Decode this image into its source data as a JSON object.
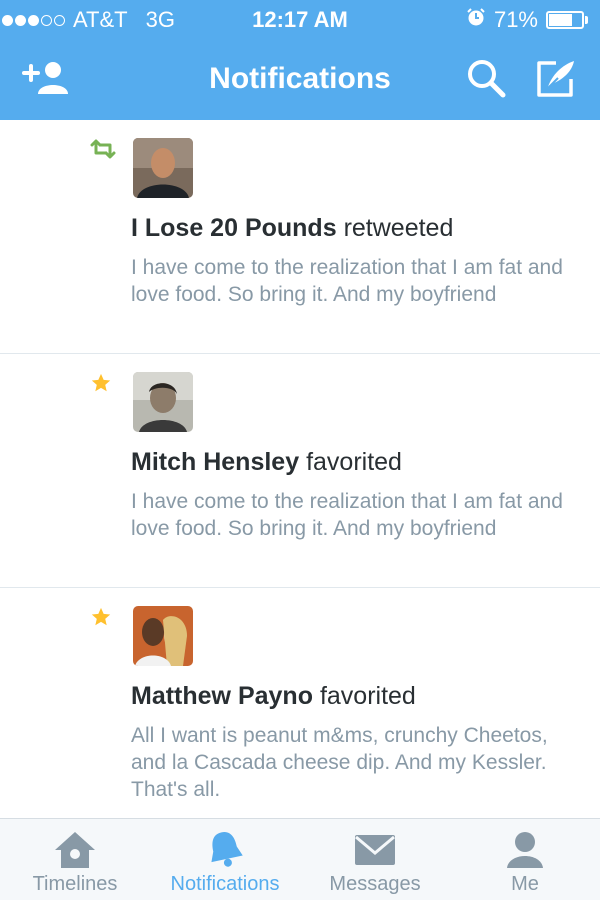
{
  "status_bar": {
    "signal_bars_filled": 3,
    "signal_bars_total": 5,
    "carrier": "AT&T",
    "network": "3G",
    "time": "12:17 AM",
    "battery_percent": "71%",
    "battery_level": 0.71
  },
  "nav": {
    "title": "Notifications",
    "left_icon": "add-user-icon",
    "right_icons": [
      "search-icon",
      "compose-icon"
    ]
  },
  "notifications": [
    {
      "type": "retweet",
      "type_icon": "retweet-icon",
      "name": "I Lose 20 Pounds",
      "action": "retweeted",
      "text": "I have come to the realization that I am fat and love food. So bring it. And my boyfriend"
    },
    {
      "type": "favorite",
      "type_icon": "star-icon",
      "name": "Mitch Hensley",
      "action": "favorited",
      "text": "I have come to the realization that I am fat and love food. So bring it. And my boyfriend"
    },
    {
      "type": "favorite",
      "type_icon": "star-icon",
      "name": "Matthew Payno",
      "action": "favorited",
      "text": "All I want is peanut m&ms, crunchy Cheetos, and la Cascada cheese dip. And my Kessler. That's all."
    }
  ],
  "tabs": [
    {
      "label": "Timelines",
      "icon": "home-icon",
      "active": false
    },
    {
      "label": "Notifications",
      "icon": "bell-icon",
      "active": true
    },
    {
      "label": "Messages",
      "icon": "envelope-icon",
      "active": false
    },
    {
      "label": "Me",
      "icon": "person-icon",
      "active": false
    }
  ],
  "colors": {
    "header": "#55acee",
    "accent": "#55acee",
    "retweet": "#77b255",
    "favorite": "#ffc02e",
    "inactive_tab": "#8899a6",
    "name_text": "#292f33",
    "tweet_text": "#8899a6"
  }
}
